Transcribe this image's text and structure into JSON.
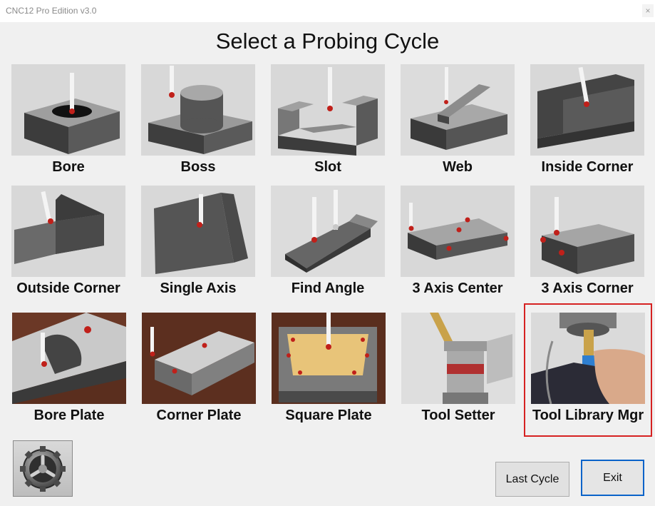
{
  "window": {
    "title": "CNC12 Pro Edition v3.0",
    "close_glyph": "×"
  },
  "heading": "Select a Probing Cycle",
  "tiles": [
    {
      "label": "Bore"
    },
    {
      "label": "Boss"
    },
    {
      "label": "Slot"
    },
    {
      "label": "Web"
    },
    {
      "label": "Inside Corner"
    },
    {
      "label": "Outside Corner"
    },
    {
      "label": "Single Axis"
    },
    {
      "label": "Find Angle"
    },
    {
      "label": "3 Axis Center"
    },
    {
      "label": "3 Axis Corner"
    },
    {
      "label": "Bore Plate"
    },
    {
      "label": "Corner Plate"
    },
    {
      "label": "Square Plate"
    },
    {
      "label": "Tool Setter"
    },
    {
      "label": "Tool Library Mgr",
      "selected": true
    }
  ],
  "buttons": {
    "last_cycle": "Last Cycle",
    "exit": "Exit",
    "settings_icon": "gear-icon"
  },
  "colors": {
    "selection_border": "#d62121",
    "focus_border": "#0a63c9",
    "probe_ball": "#c0201a"
  }
}
